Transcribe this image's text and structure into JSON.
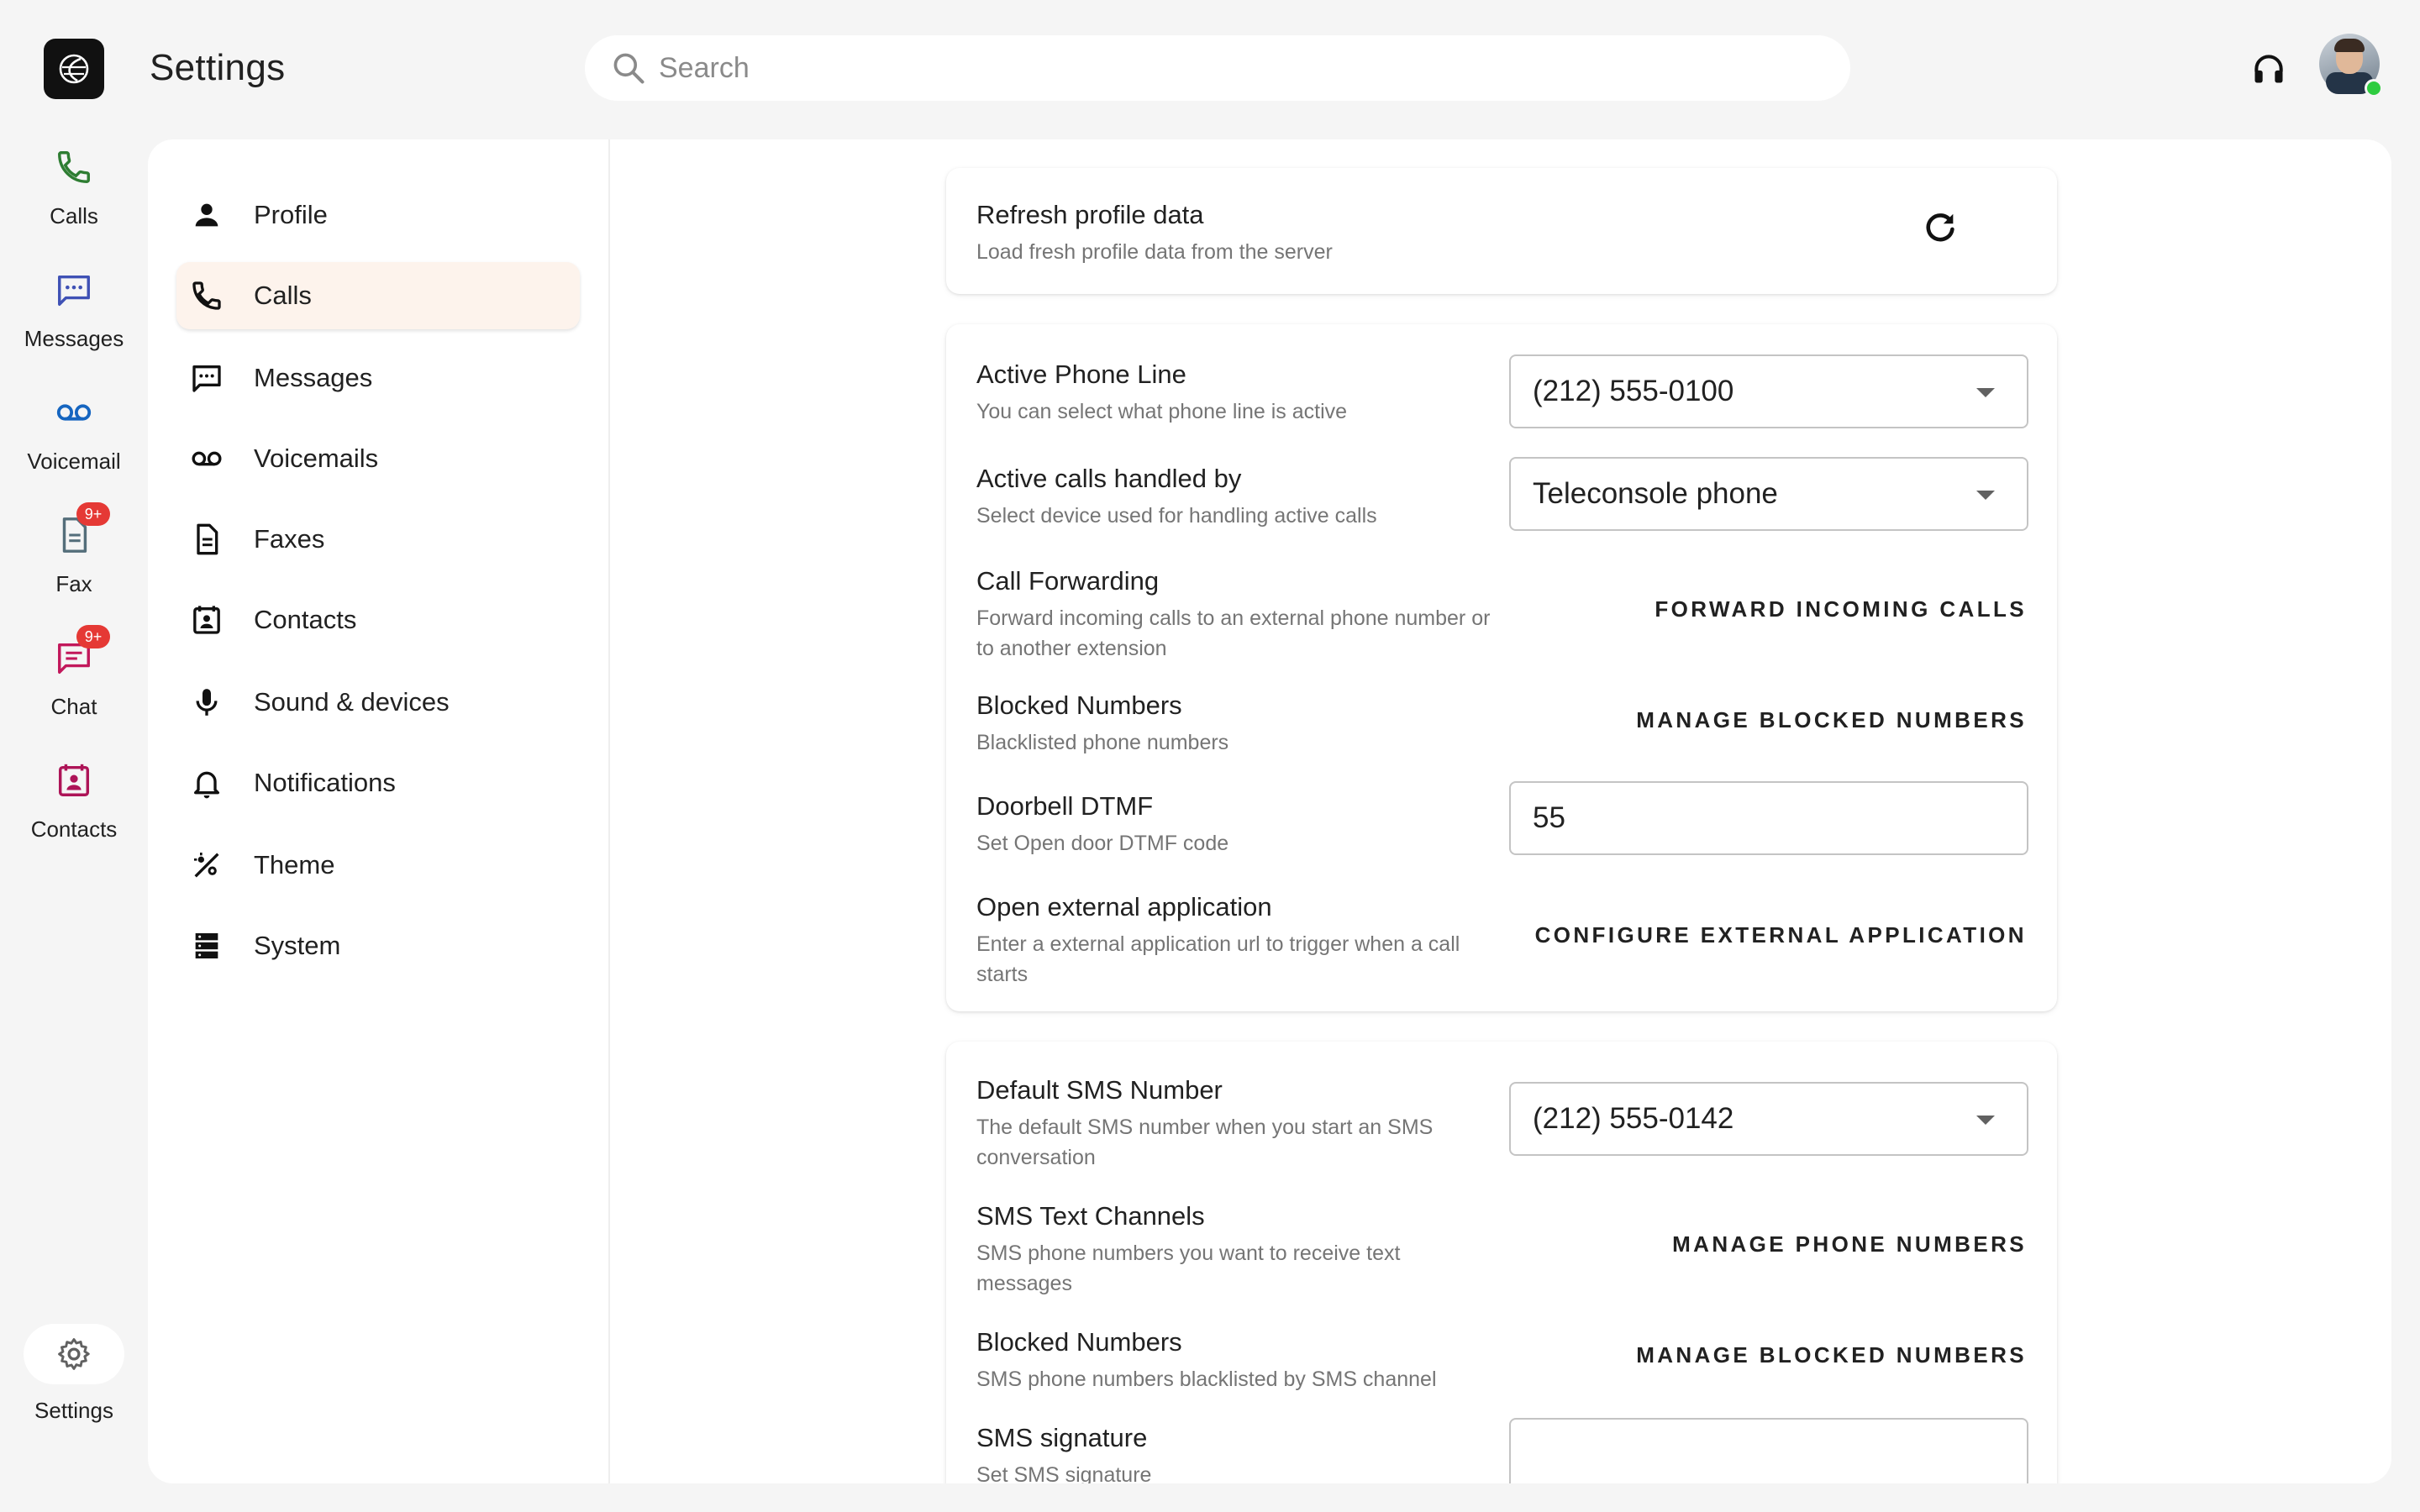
{
  "header": {
    "title": "Settings",
    "search_placeholder": "Search"
  },
  "rail": {
    "items": [
      {
        "label": "Calls",
        "icon": "phone-icon",
        "color": "#2e7d32"
      },
      {
        "label": "Messages",
        "icon": "message-icon",
        "color": "#3f51b5"
      },
      {
        "label": "Voicemail",
        "icon": "voicemail-icon",
        "color": "#1565c0"
      },
      {
        "label": "Fax",
        "icon": "fax-icon",
        "badge": "9+",
        "color": "#546e7a"
      },
      {
        "label": "Chat",
        "icon": "chat-icon",
        "badge": "9+",
        "color": "#c2185b"
      },
      {
        "label": "Contacts",
        "icon": "contacts-icon",
        "color": "#ad1457"
      }
    ],
    "settings_label": "Settings"
  },
  "menu": {
    "items": [
      {
        "label": "Profile"
      },
      {
        "label": "Calls",
        "active": true
      },
      {
        "label": "Messages"
      },
      {
        "label": "Voicemails"
      },
      {
        "label": "Faxes"
      },
      {
        "label": "Contacts"
      },
      {
        "label": "Sound & devices"
      },
      {
        "label": "Notifications"
      },
      {
        "label": "Theme"
      },
      {
        "label": "System"
      }
    ]
  },
  "refresh_card": {
    "title": "Refresh profile data",
    "subtitle": "Load fresh profile data from the server"
  },
  "calls_card": {
    "active_line": {
      "title": "Active Phone Line",
      "subtitle": "You can select what phone line is active",
      "value": "(212) 555-0100"
    },
    "handled_by": {
      "title": "Active calls handled by",
      "subtitle": "Select device used for handling active calls",
      "value": "Teleconsole phone"
    },
    "forwarding": {
      "title": "Call Forwarding",
      "subtitle": "Forward incoming calls to an external phone number or to another extension",
      "button": "FORWARD INCOMING CALLS"
    },
    "blocked": {
      "title": "Blocked Numbers",
      "subtitle": "Blacklisted phone numbers",
      "button": "MANAGE BLOCKED NUMBERS"
    },
    "doorbell": {
      "title": "Doorbell DTMF",
      "subtitle": "Set Open door DTMF code",
      "value": "55"
    },
    "external_app": {
      "title": "Open external application",
      "subtitle": "Enter a external application url to trigger when a call starts",
      "button": "CONFIGURE EXTERNAL APPLICATION"
    }
  },
  "sms_card": {
    "default_number": {
      "title": "Default SMS Number",
      "subtitle": "The default SMS number when you start an SMS conversation",
      "value": "(212) 555-0142"
    },
    "channels": {
      "title": "SMS Text Channels",
      "subtitle": "SMS phone numbers you want to receive text messages",
      "button": "MANAGE PHONE NUMBERS"
    },
    "blocked": {
      "title": "Blocked Numbers",
      "subtitle": "SMS phone numbers blacklisted by SMS channel",
      "button": "MANAGE BLOCKED NUMBERS"
    },
    "signature": {
      "title": "SMS signature",
      "subtitle": "Set SMS signature",
      "value": ""
    }
  }
}
